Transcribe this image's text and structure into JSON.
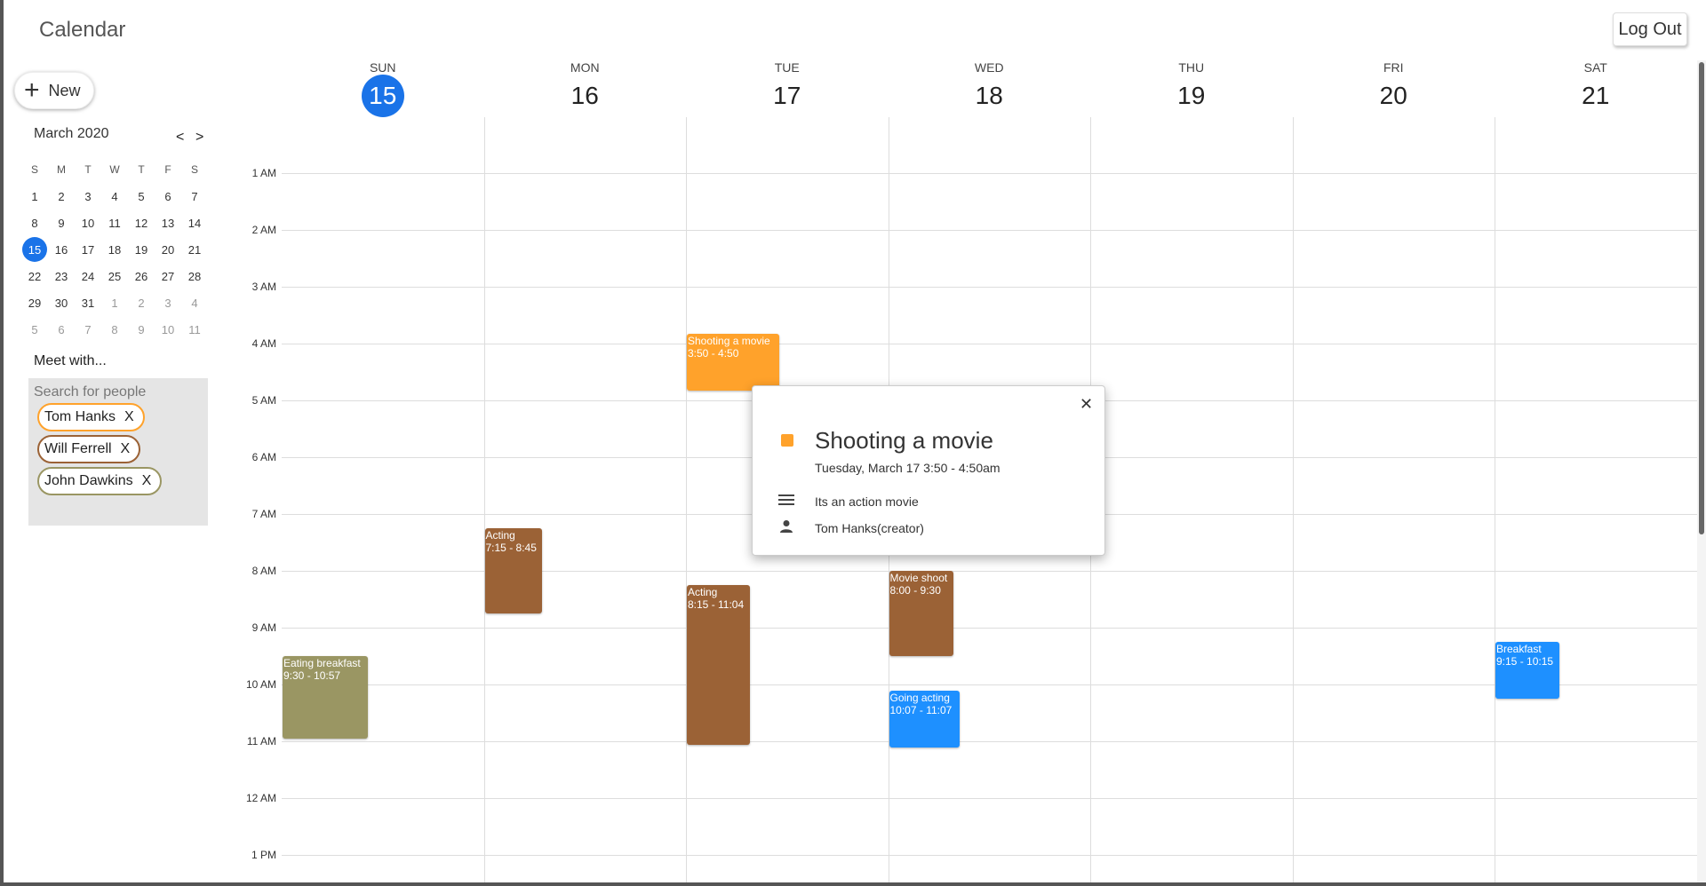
{
  "app": {
    "title": "Calendar",
    "logout_label": "Log Out"
  },
  "sidebar": {
    "new_label": "New",
    "mini_calendar": {
      "month_label": "March 2020",
      "prev_label": "<",
      "next_label": ">",
      "weekday_headers": [
        "S",
        "M",
        "T",
        "W",
        "T",
        "F",
        "S"
      ],
      "weeks": [
        [
          "1",
          "2",
          "3",
          "4",
          "5",
          "6",
          "7"
        ],
        [
          "8",
          "9",
          "10",
          "11",
          "12",
          "13",
          "14"
        ],
        [
          "15",
          "16",
          "17",
          "18",
          "19",
          "20",
          "21"
        ],
        [
          "22",
          "23",
          "24",
          "25",
          "26",
          "27",
          "28"
        ],
        [
          "29",
          "30",
          "31",
          "1",
          "2",
          "3",
          "4"
        ],
        [
          "5",
          "6",
          "7",
          "8",
          "9",
          "10",
          "11"
        ]
      ],
      "selected": "15"
    },
    "meet_with_label": "Meet with...",
    "search_placeholder": "Search for people",
    "people": [
      {
        "name": "Tom Hanks",
        "remove_label": "X",
        "color": "#ffa22b"
      },
      {
        "name": "Will Ferrell",
        "remove_label": "X",
        "color": "#9b6236"
      },
      {
        "name": "John Dawkins",
        "remove_label": "X",
        "color": "#9a9663"
      }
    ]
  },
  "week": {
    "days": [
      {
        "dow": "SUN",
        "date": "15",
        "today": true
      },
      {
        "dow": "MON",
        "date": "16"
      },
      {
        "dow": "TUE",
        "date": "17"
      },
      {
        "dow": "WED",
        "date": "18"
      },
      {
        "dow": "THU",
        "date": "19"
      },
      {
        "dow": "FRI",
        "date": "20"
      },
      {
        "dow": "SAT",
        "date": "21"
      }
    ],
    "hour_labels": [
      "1 AM",
      "2 AM",
      "3 AM",
      "4 AM",
      "5 AM",
      "6 AM",
      "7 AM",
      "8 AM",
      "9 AM",
      "10 AM",
      "11 AM",
      "12 AM",
      "1 PM"
    ],
    "events": [
      {
        "title": "Eating breakfast",
        "time": "9:30 - 10:57",
        "day": 0,
        "start": 9.5,
        "end": 10.95,
        "color": "#9a9663"
      },
      {
        "title": "Acting",
        "time": "7:15 - 8:45",
        "day": 1,
        "start": 7.25,
        "end": 8.75,
        "color": "#9b6236"
      },
      {
        "title": "Shooting a movie",
        "time": "3:50 - 4:50",
        "day": 2,
        "start": 3.833,
        "end": 4.833,
        "color": "#ffa22b"
      },
      {
        "title": "Acting",
        "time": "8:15 - 11:04",
        "day": 2,
        "start": 8.25,
        "end": 11.067,
        "color": "#9b6236"
      },
      {
        "title": "Movie shoot",
        "time": "8:00 - 9:30",
        "day": 3,
        "start": 8.0,
        "end": 9.5,
        "color": "#9b6236"
      },
      {
        "title": "Going acting",
        "time": "10:07 - 11:07",
        "day": 3,
        "start": 10.117,
        "end": 11.117,
        "color": "#1e90ff"
      },
      {
        "title": "Breakfast",
        "time": "9:15 - 10:15",
        "day": 6,
        "start": 9.25,
        "end": 10.25,
        "color": "#1e90ff"
      }
    ]
  },
  "popup": {
    "close_label": "✕",
    "title": "Shooting a movie",
    "datetime": "Tuesday, March 17 3:50 - 4:50am",
    "description": "Its an action movie",
    "creator": "Tom Hanks(creator)",
    "color": "#ffa22b"
  }
}
